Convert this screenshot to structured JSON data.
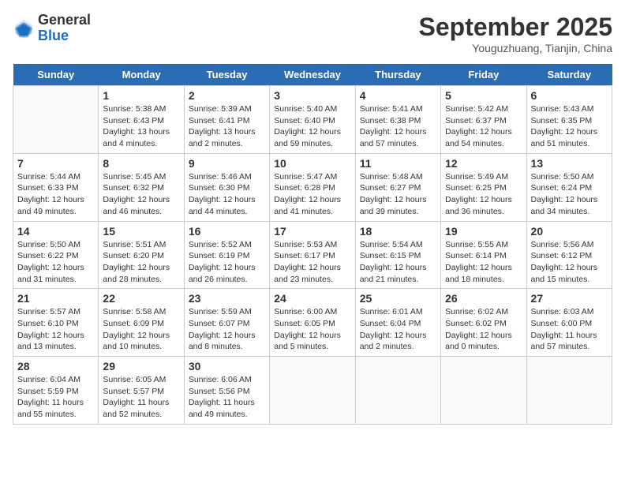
{
  "header": {
    "logo_general": "General",
    "logo_blue": "Blue",
    "month": "September 2025",
    "location": "Youguzhuang, Tianjin, China"
  },
  "days_of_week": [
    "Sunday",
    "Monday",
    "Tuesday",
    "Wednesday",
    "Thursday",
    "Friday",
    "Saturday"
  ],
  "weeks": [
    [
      {
        "day": "",
        "info": ""
      },
      {
        "day": "1",
        "info": "Sunrise: 5:38 AM\nSunset: 6:43 PM\nDaylight: 13 hours\nand 4 minutes."
      },
      {
        "day": "2",
        "info": "Sunrise: 5:39 AM\nSunset: 6:41 PM\nDaylight: 13 hours\nand 2 minutes."
      },
      {
        "day": "3",
        "info": "Sunrise: 5:40 AM\nSunset: 6:40 PM\nDaylight: 12 hours\nand 59 minutes."
      },
      {
        "day": "4",
        "info": "Sunrise: 5:41 AM\nSunset: 6:38 PM\nDaylight: 12 hours\nand 57 minutes."
      },
      {
        "day": "5",
        "info": "Sunrise: 5:42 AM\nSunset: 6:37 PM\nDaylight: 12 hours\nand 54 minutes."
      },
      {
        "day": "6",
        "info": "Sunrise: 5:43 AM\nSunset: 6:35 PM\nDaylight: 12 hours\nand 51 minutes."
      }
    ],
    [
      {
        "day": "7",
        "info": "Sunrise: 5:44 AM\nSunset: 6:33 PM\nDaylight: 12 hours\nand 49 minutes."
      },
      {
        "day": "8",
        "info": "Sunrise: 5:45 AM\nSunset: 6:32 PM\nDaylight: 12 hours\nand 46 minutes."
      },
      {
        "day": "9",
        "info": "Sunrise: 5:46 AM\nSunset: 6:30 PM\nDaylight: 12 hours\nand 44 minutes."
      },
      {
        "day": "10",
        "info": "Sunrise: 5:47 AM\nSunset: 6:28 PM\nDaylight: 12 hours\nand 41 minutes."
      },
      {
        "day": "11",
        "info": "Sunrise: 5:48 AM\nSunset: 6:27 PM\nDaylight: 12 hours\nand 39 minutes."
      },
      {
        "day": "12",
        "info": "Sunrise: 5:49 AM\nSunset: 6:25 PM\nDaylight: 12 hours\nand 36 minutes."
      },
      {
        "day": "13",
        "info": "Sunrise: 5:50 AM\nSunset: 6:24 PM\nDaylight: 12 hours\nand 34 minutes."
      }
    ],
    [
      {
        "day": "14",
        "info": "Sunrise: 5:50 AM\nSunset: 6:22 PM\nDaylight: 12 hours\nand 31 minutes."
      },
      {
        "day": "15",
        "info": "Sunrise: 5:51 AM\nSunset: 6:20 PM\nDaylight: 12 hours\nand 28 minutes."
      },
      {
        "day": "16",
        "info": "Sunrise: 5:52 AM\nSunset: 6:19 PM\nDaylight: 12 hours\nand 26 minutes."
      },
      {
        "day": "17",
        "info": "Sunrise: 5:53 AM\nSunset: 6:17 PM\nDaylight: 12 hours\nand 23 minutes."
      },
      {
        "day": "18",
        "info": "Sunrise: 5:54 AM\nSunset: 6:15 PM\nDaylight: 12 hours\nand 21 minutes."
      },
      {
        "day": "19",
        "info": "Sunrise: 5:55 AM\nSunset: 6:14 PM\nDaylight: 12 hours\nand 18 minutes."
      },
      {
        "day": "20",
        "info": "Sunrise: 5:56 AM\nSunset: 6:12 PM\nDaylight: 12 hours\nand 15 minutes."
      }
    ],
    [
      {
        "day": "21",
        "info": "Sunrise: 5:57 AM\nSunset: 6:10 PM\nDaylight: 12 hours\nand 13 minutes."
      },
      {
        "day": "22",
        "info": "Sunrise: 5:58 AM\nSunset: 6:09 PM\nDaylight: 12 hours\nand 10 minutes."
      },
      {
        "day": "23",
        "info": "Sunrise: 5:59 AM\nSunset: 6:07 PM\nDaylight: 12 hours\nand 8 minutes."
      },
      {
        "day": "24",
        "info": "Sunrise: 6:00 AM\nSunset: 6:05 PM\nDaylight: 12 hours\nand 5 minutes."
      },
      {
        "day": "25",
        "info": "Sunrise: 6:01 AM\nSunset: 6:04 PM\nDaylight: 12 hours\nand 2 minutes."
      },
      {
        "day": "26",
        "info": "Sunrise: 6:02 AM\nSunset: 6:02 PM\nDaylight: 12 hours\nand 0 minutes."
      },
      {
        "day": "27",
        "info": "Sunrise: 6:03 AM\nSunset: 6:00 PM\nDaylight: 11 hours\nand 57 minutes."
      }
    ],
    [
      {
        "day": "28",
        "info": "Sunrise: 6:04 AM\nSunset: 5:59 PM\nDaylight: 11 hours\nand 55 minutes."
      },
      {
        "day": "29",
        "info": "Sunrise: 6:05 AM\nSunset: 5:57 PM\nDaylight: 11 hours\nand 52 minutes."
      },
      {
        "day": "30",
        "info": "Sunrise: 6:06 AM\nSunset: 5:56 PM\nDaylight: 11 hours\nand 49 minutes."
      },
      {
        "day": "",
        "info": ""
      },
      {
        "day": "",
        "info": ""
      },
      {
        "day": "",
        "info": ""
      },
      {
        "day": "",
        "info": ""
      }
    ]
  ]
}
